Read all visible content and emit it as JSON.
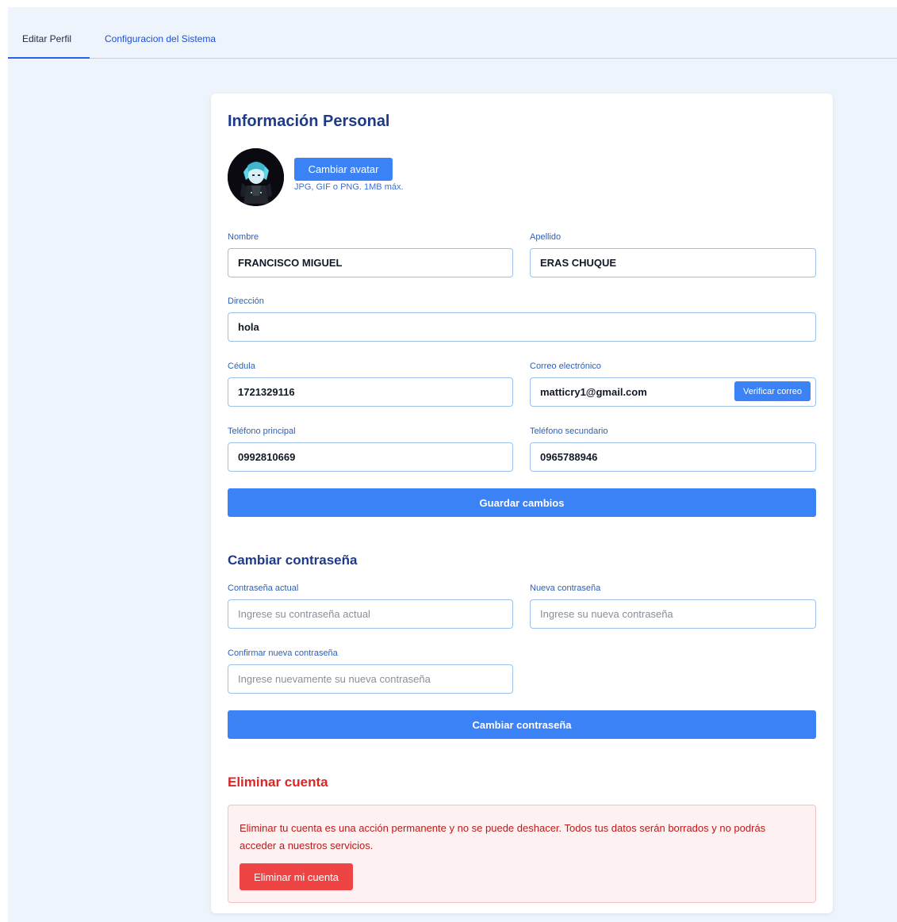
{
  "tabs": [
    {
      "label": "Editar Perfil"
    },
    {
      "label": "Configuracion del Sistema"
    }
  ],
  "profile": {
    "title": "Información Personal",
    "change_avatar_label": "Cambiar avatar",
    "avatar_hint": "JPG, GIF o PNG. 1MB máx.",
    "fields": {
      "nombre": {
        "label": "Nombre",
        "value": "FRANCISCO MIGUEL"
      },
      "apellido": {
        "label": "Apellido",
        "value": "ERAS CHUQUE"
      },
      "direccion": {
        "label": "Dirección",
        "value": "hola"
      },
      "cedula": {
        "label": "Cédula",
        "value": "1721329116"
      },
      "correo": {
        "label": "Correo electrónico",
        "value": "matticry1@gmail.com"
      },
      "telefono_principal": {
        "label": "Teléfono principal",
        "value": "0992810669"
      },
      "telefono_secundario": {
        "label": "Teléfono secundario",
        "value": "0965788946"
      }
    },
    "verify_email_label": "Verificar correo",
    "save_label": "Guardar cambios"
  },
  "password": {
    "title": "Cambiar contraseña",
    "current": {
      "label": "Contraseña actual",
      "placeholder": "Ingrese su contraseña actual"
    },
    "new": {
      "label": "Nueva contraseña",
      "placeholder": "Ingrese su nueva contraseña"
    },
    "confirm": {
      "label": "Confirmar nueva contraseña",
      "placeholder": "Ingrese nuevamente su nueva contraseña"
    },
    "submit_label": "Cambiar contraseña"
  },
  "delete_account": {
    "title": "Eliminar cuenta",
    "warning": "Eliminar tu cuenta es una acción permanente y no se puede deshacer. Todos tus datos serán borrados y no podrás acceder a nuestros servicios.",
    "button_label": "Eliminar mi cuenta"
  },
  "colors": {
    "primary": "#3b82f6",
    "heading": "#1e3a8a",
    "danger": "#dc2626",
    "background": "#eef4fb"
  }
}
